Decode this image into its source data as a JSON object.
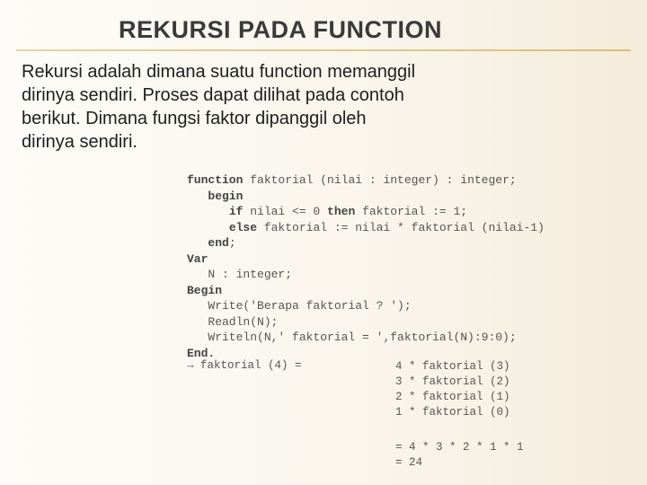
{
  "title": "REKURSI PADA FUNCTION",
  "paragraph": {
    "l1": "Rekursi adalah dimana suatu function memanggil",
    "l2": "dirinya sendiri. Proses dapat  dilihat  pada  contoh",
    "l3": "berikut.  Dimana  fungsi  faktor  dipanggil  oleh",
    "l4": "dirinya sendiri."
  },
  "code": {
    "l1a": "function",
    "l1b": " faktorial (nilai : integer) : integer;",
    "l2": "begin",
    "l3a": "if",
    "l3b": " nilai <= 0 ",
    "l3c": "then",
    "l3d": " faktorial := 1;",
    "l4a": "else",
    "l4b": " faktorial := nilai * faktorial (nilai-1)",
    "l5": "end",
    "l6": "Var",
    "l7": "N : integer;",
    "l8": "Begin",
    "l9": "Write('Berapa faktorial ? ');",
    "l10": "Readln(N);",
    "l11": "Writeln(N,' faktorial = ',faktorial(N):9:0);",
    "l12": "End."
  },
  "trace_left": "→ faktorial (4) =",
  "trace_right": {
    "r1": "4 * faktorial (3)",
    "r2": "3 * faktorial (2)",
    "r3": "2 * faktorial (1)",
    "r4": "1 * faktorial (0)"
  },
  "result": {
    "r1": "= 4 * 3 * 2 * 1 * 1",
    "r2": "= 24"
  }
}
